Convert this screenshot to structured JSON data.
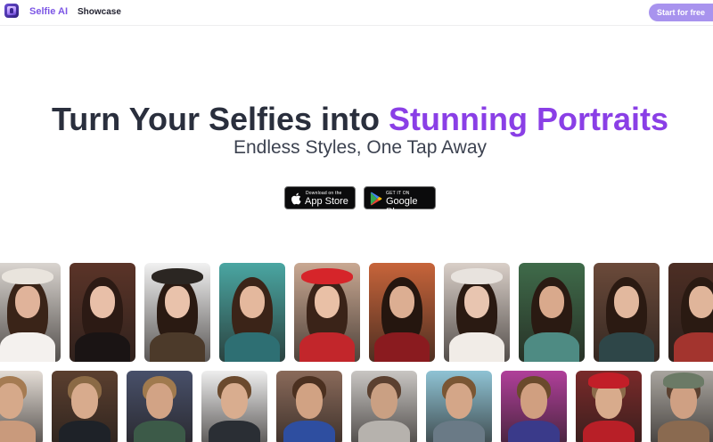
{
  "nav": {
    "brand": "Selfie AI",
    "showcase": "Showcase",
    "cta": "Start for free"
  },
  "hero": {
    "title_main": "Turn Your Selfies into ",
    "title_accent": "Stunning Portraits",
    "subtitle": "Endless Styles, One Tap Away"
  },
  "stores": {
    "apple_small": "Download on the",
    "apple_big": "App Store",
    "google_small": "GET IT ON",
    "google_big": "Google Play"
  },
  "colors": {
    "brand": "#7c56e5",
    "accent": "#8a3fe6",
    "cta": "#a893ee",
    "title": "#2a2f3d"
  },
  "gallery": {
    "row1": [
      {
        "name": "woman-white-hat",
        "bg": "#d9d4cf",
        "hair": "#3a2418",
        "face": "#e0b39a",
        "body": "#f4f1ee",
        "hat": "#e9e4dd"
      },
      {
        "name": "woman-lingerie-chandelier",
        "bg": "#5b3428",
        "hair": "#2c1a14",
        "face": "#e8bfa8",
        "body": "#1a1414",
        "hat": ""
      },
      {
        "name": "woman-pirate",
        "bg": "#f1f1f1",
        "hair": "#2a1a12",
        "face": "#e9c2ab",
        "body": "#4c3a2a",
        "hat": "#2b2622"
      },
      {
        "name": "woman-teal-glow",
        "bg": "#4aa6a2",
        "hair": "#3b2418",
        "face": "#e4b89d",
        "body": "#2e6f73",
        "hat": ""
      },
      {
        "name": "woman-santa-hat",
        "bg": "#c9a892",
        "hair": "#3a2318",
        "face": "#e9c0a6",
        "body": "#c2262b",
        "hat": "#d6252a"
      },
      {
        "name": "woman-superhero-sunset",
        "bg": "#c7643a",
        "hair": "#25160f",
        "face": "#dcae92",
        "body": "#8a1b1f",
        "hat": ""
      },
      {
        "name": "woman-bride",
        "bg": "#d9cfc8",
        "hair": "#2a1a12",
        "face": "#e8c5b0",
        "body": "#f1ece7",
        "hat": "#e8e3de"
      },
      {
        "name": "woman-jungle-pool",
        "bg": "#3f6b4a",
        "hair": "#2a1a12",
        "face": "#d9a98c",
        "body": "#4e8b83",
        "hat": ""
      },
      {
        "name": "woman-cafe",
        "bg": "#6b4a3a",
        "hair": "#2b1a12",
        "face": "#e2b89e",
        "body": "#2e4648",
        "hat": ""
      },
      {
        "name": "woman-renaissance",
        "bg": "#4d2e24",
        "hair": "#2a1a12",
        "face": "#e0b59a",
        "body": "#a3342e",
        "hat": ""
      }
    ],
    "row2": [
      {
        "name": "man-tattoo",
        "bg": "#e4ddd6",
        "hair": "#a57b52",
        "face": "#d6a98a",
        "body": "#c99a7c",
        "hat": ""
      },
      {
        "name": "man-suit-office",
        "bg": "#5b3f2f",
        "hair": "#8b6a45",
        "face": "#d8ab8d",
        "body": "#1e2228",
        "hat": ""
      },
      {
        "name": "man-gamer",
        "bg": "#48506a",
        "hair": "#a07a4e",
        "face": "#d2a385",
        "body": "#3c5a48",
        "hat": ""
      },
      {
        "name": "man-suit-studio",
        "bg": "#eeeeee",
        "hair": "#6b4a2e",
        "face": "#d9ad8f",
        "body": "#2a2e34",
        "hat": ""
      },
      {
        "name": "man-superhero",
        "bg": "#8a6a5a",
        "hair": "#4b3020",
        "face": "#d1a283",
        "body": "#2e4ea0",
        "hat": ""
      },
      {
        "name": "man-sunglasses",
        "bg": "#c9c6c3",
        "hair": "#5b4030",
        "face": "#caa083",
        "body": "#b6b2ad",
        "hat": ""
      },
      {
        "name": "man-beach",
        "bg": "#8fc3d4",
        "hair": "#7a5634",
        "face": "#d4a688",
        "body": "#6a7a86",
        "hat": ""
      },
      {
        "name": "man-neon",
        "bg": "#b03f9a",
        "hair": "#6a4a2c",
        "face": "#d09f80",
        "body": "#3a3a8a",
        "hat": ""
      },
      {
        "name": "man-santa-hood",
        "bg": "#7a2a2a",
        "hair": "#8b6a4a",
        "face": "#d8ab8c",
        "body": "#b81f27",
        "hat": "#c21e28"
      },
      {
        "name": "man-feather-headdress",
        "bg": "#a9a59f",
        "hair": "#5a4030",
        "face": "#cfa083",
        "body": "#8a6a50",
        "hat": "#6b7a66"
      }
    ]
  }
}
